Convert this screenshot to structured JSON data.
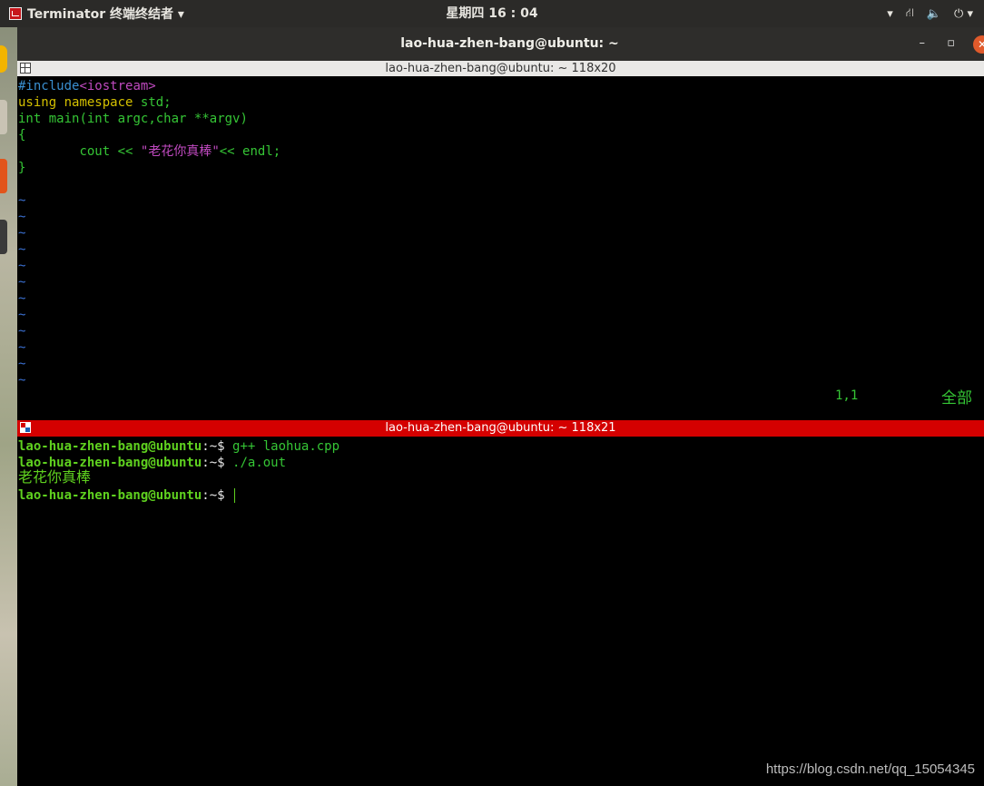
{
  "top_panel": {
    "app_title": "Terminator 终端终结者 ▾",
    "clock": "星期四 16 : 04",
    "tray_menu": "▾",
    "tray_network": "⛙",
    "tray_volume": "🔈",
    "tray_power": "⏻ ▾"
  },
  "window": {
    "title": "lao-hua-zhen-bang@ubuntu: ~",
    "minimize": "–",
    "maximize": "▫",
    "close": "✕"
  },
  "pane1": {
    "header": "lao-hua-zhen-bang@ubuntu: ~ 118x20",
    "code": {
      "l1_directive": "#include",
      "l1_header": "<iostream>",
      "l2_kw1": "using",
      "l2_kw2": "namespace",
      "l2_rest": "std;",
      "l3_type": "int",
      "l3_mid": "main(int",
      "l3_arg1": "argc,char",
      "l3_arg2": "**argv)",
      "l4": "{",
      "l5_stmt": "cout <<",
      "l5_string": "\"老花你真棒\"",
      "l5_tail": "<< endl;",
      "l6": "}",
      "tilde": "~"
    },
    "status_position": "1,1",
    "status_scope": "全部"
  },
  "pane2": {
    "header": "lao-hua-zhen-bang@ubuntu: ~ 118x21",
    "prompt_user": "lao-hua-zhen-bang@ubuntu",
    "prompt_sep": ":~$",
    "cmd1": "g++ laohua.cpp",
    "cmd2": "./a.out",
    "output": "老花你真棒"
  },
  "watermark": "https://blog.csdn.net/qq_15054345"
}
